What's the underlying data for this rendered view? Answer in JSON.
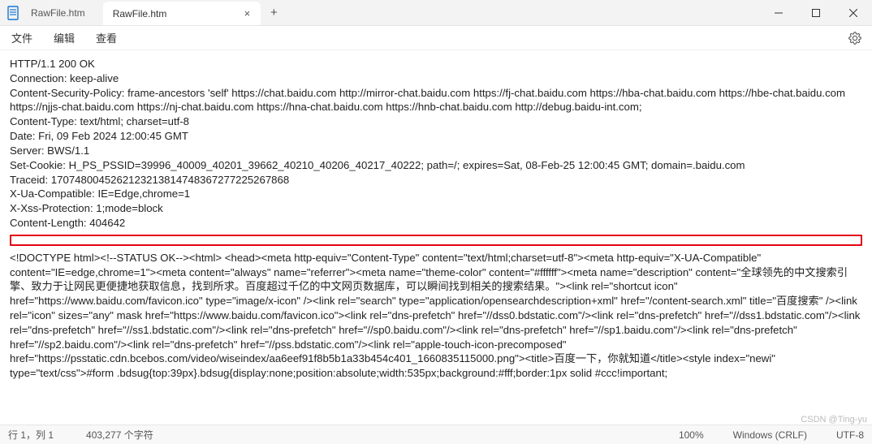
{
  "window": {
    "inactive_tab": "RawFile.htm",
    "active_tab": "RawFile.htm",
    "close_glyph": "×",
    "add_glyph": "+"
  },
  "menubar": {
    "file": "文件",
    "edit": "编辑",
    "view": "查看"
  },
  "headers": {
    "status": "HTTP/1.1 200 OK",
    "connection": "Connection: keep-alive",
    "csp": "Content-Security-Policy: frame-ancestors 'self' https://chat.baidu.com http://mirror-chat.baidu.com https://fj-chat.baidu.com https://hba-chat.baidu.com https://hbe-chat.baidu.com https://njjs-chat.baidu.com https://nj-chat.baidu.com https://hna-chat.baidu.com https://hnb-chat.baidu.com http://debug.baidu-int.com;",
    "content_type": "Content-Type: text/html; charset=utf-8",
    "date": "Date: Fri, 09 Feb 2024 12:00:45 GMT",
    "server": "Server: BWS/1.1",
    "set_cookie": "Set-Cookie: H_PS_PSSID=39996_40009_40201_39662_40210_40206_40217_40222; path=/; expires=Sat, 08-Feb-25 12:00:45 GMT; domain=.baidu.com",
    "traceid": "Traceid: 1707480045262123213814748367277225267868",
    "xua": "X-Ua-Compatible: IE=Edge,chrome=1",
    "xss": "X-Xss-Protection: 1;mode=block",
    "content_length": "Content-Length: 404642"
  },
  "body_html": "<!DOCTYPE html><!--STATUS OK--><html> <head><meta http-equiv=\"Content-Type\" content=\"text/html;charset=utf-8\"><meta http-equiv=\"X-UA-Compatible\" content=\"IE=edge,chrome=1\"><meta content=\"always\" name=\"referrer\"><meta name=\"theme-color\" content=\"#ffffff\"><meta name=\"description\" content=\"全球领先的中文搜索引擎、致力于让网民更便捷地获取信息，找到所求。百度超过千亿的中文网页数据库，可以瞬间找到相关的搜索结果。\"><link rel=\"shortcut icon\" href=\"https://www.baidu.com/favicon.ico\" type=\"image/x-icon\" /><link rel=\"search\" type=\"application/opensearchdescription+xml\" href=\"/content-search.xml\" title=\"百度搜索\" /><link rel=\"icon\" sizes=\"any\" mask href=\"https://www.baidu.com/favicon.ico\"><link rel=\"dns-prefetch\" href=\"//dss0.bdstatic.com\"/><link rel=\"dns-prefetch\" href=\"//dss1.bdstatic.com\"/><link rel=\"dns-prefetch\" href=\"//ss1.bdstatic.com\"/><link rel=\"dns-prefetch\" href=\"//sp0.baidu.com\"/><link rel=\"dns-prefetch\" href=\"//sp1.baidu.com\"/><link rel=\"dns-prefetch\" href=\"//sp2.baidu.com\"/><link rel=\"dns-prefetch\" href=\"//pss.bdstatic.com\"/><link rel=\"apple-touch-icon-precomposed\" href=\"https://psstatic.cdn.bcebos.com/video/wiseindex/aa6eef91f8b5b1a33b454c401_1660835115000.png\"><title>百度一下，你就知道</title><style index=\"newi\" type=\"text/css\">#form .bdsug{top:39px}.bdsug{display:none;position:absolute;width:535px;background:#fff;border:1px solid #ccc!important;",
  "status": {
    "position": "行 1，列 1",
    "chars": "403,277 个字符",
    "zoom": "100%",
    "eol": "Windows (CRLF)",
    "encoding": "UTF-8"
  },
  "watermark": "CSDN @Ting-yu"
}
